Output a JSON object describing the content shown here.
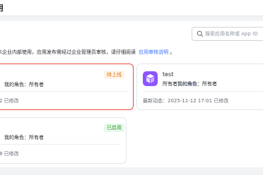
{
  "page": {
    "title": "用"
  },
  "search": {
    "placeholder": "搜索应用名称或 App ID"
  },
  "notice": {
    "text": "本企业内部使用，应用发布需经过企业管理员审核，请仔细阅读",
    "link": "应用审核说明",
    "suffix": "。"
  },
  "cards": [
    {
      "badge": "待上线",
      "role": "我的角色：所有者",
      "modified": "2 已修改"
    },
    {
      "name": "test",
      "owner_label": "所有者：",
      "role": "我的角色：所有者",
      "modified": "最新动态：2025-11-12 17:01 已修改"
    },
    {
      "badge": "已启用",
      "role": "我的角色：所有者",
      "modified": "8 已修改"
    }
  ],
  "colors": {
    "accent": "#3370ff",
    "selected_border": "#e74c3c",
    "app_icon": "#8d55ff"
  }
}
